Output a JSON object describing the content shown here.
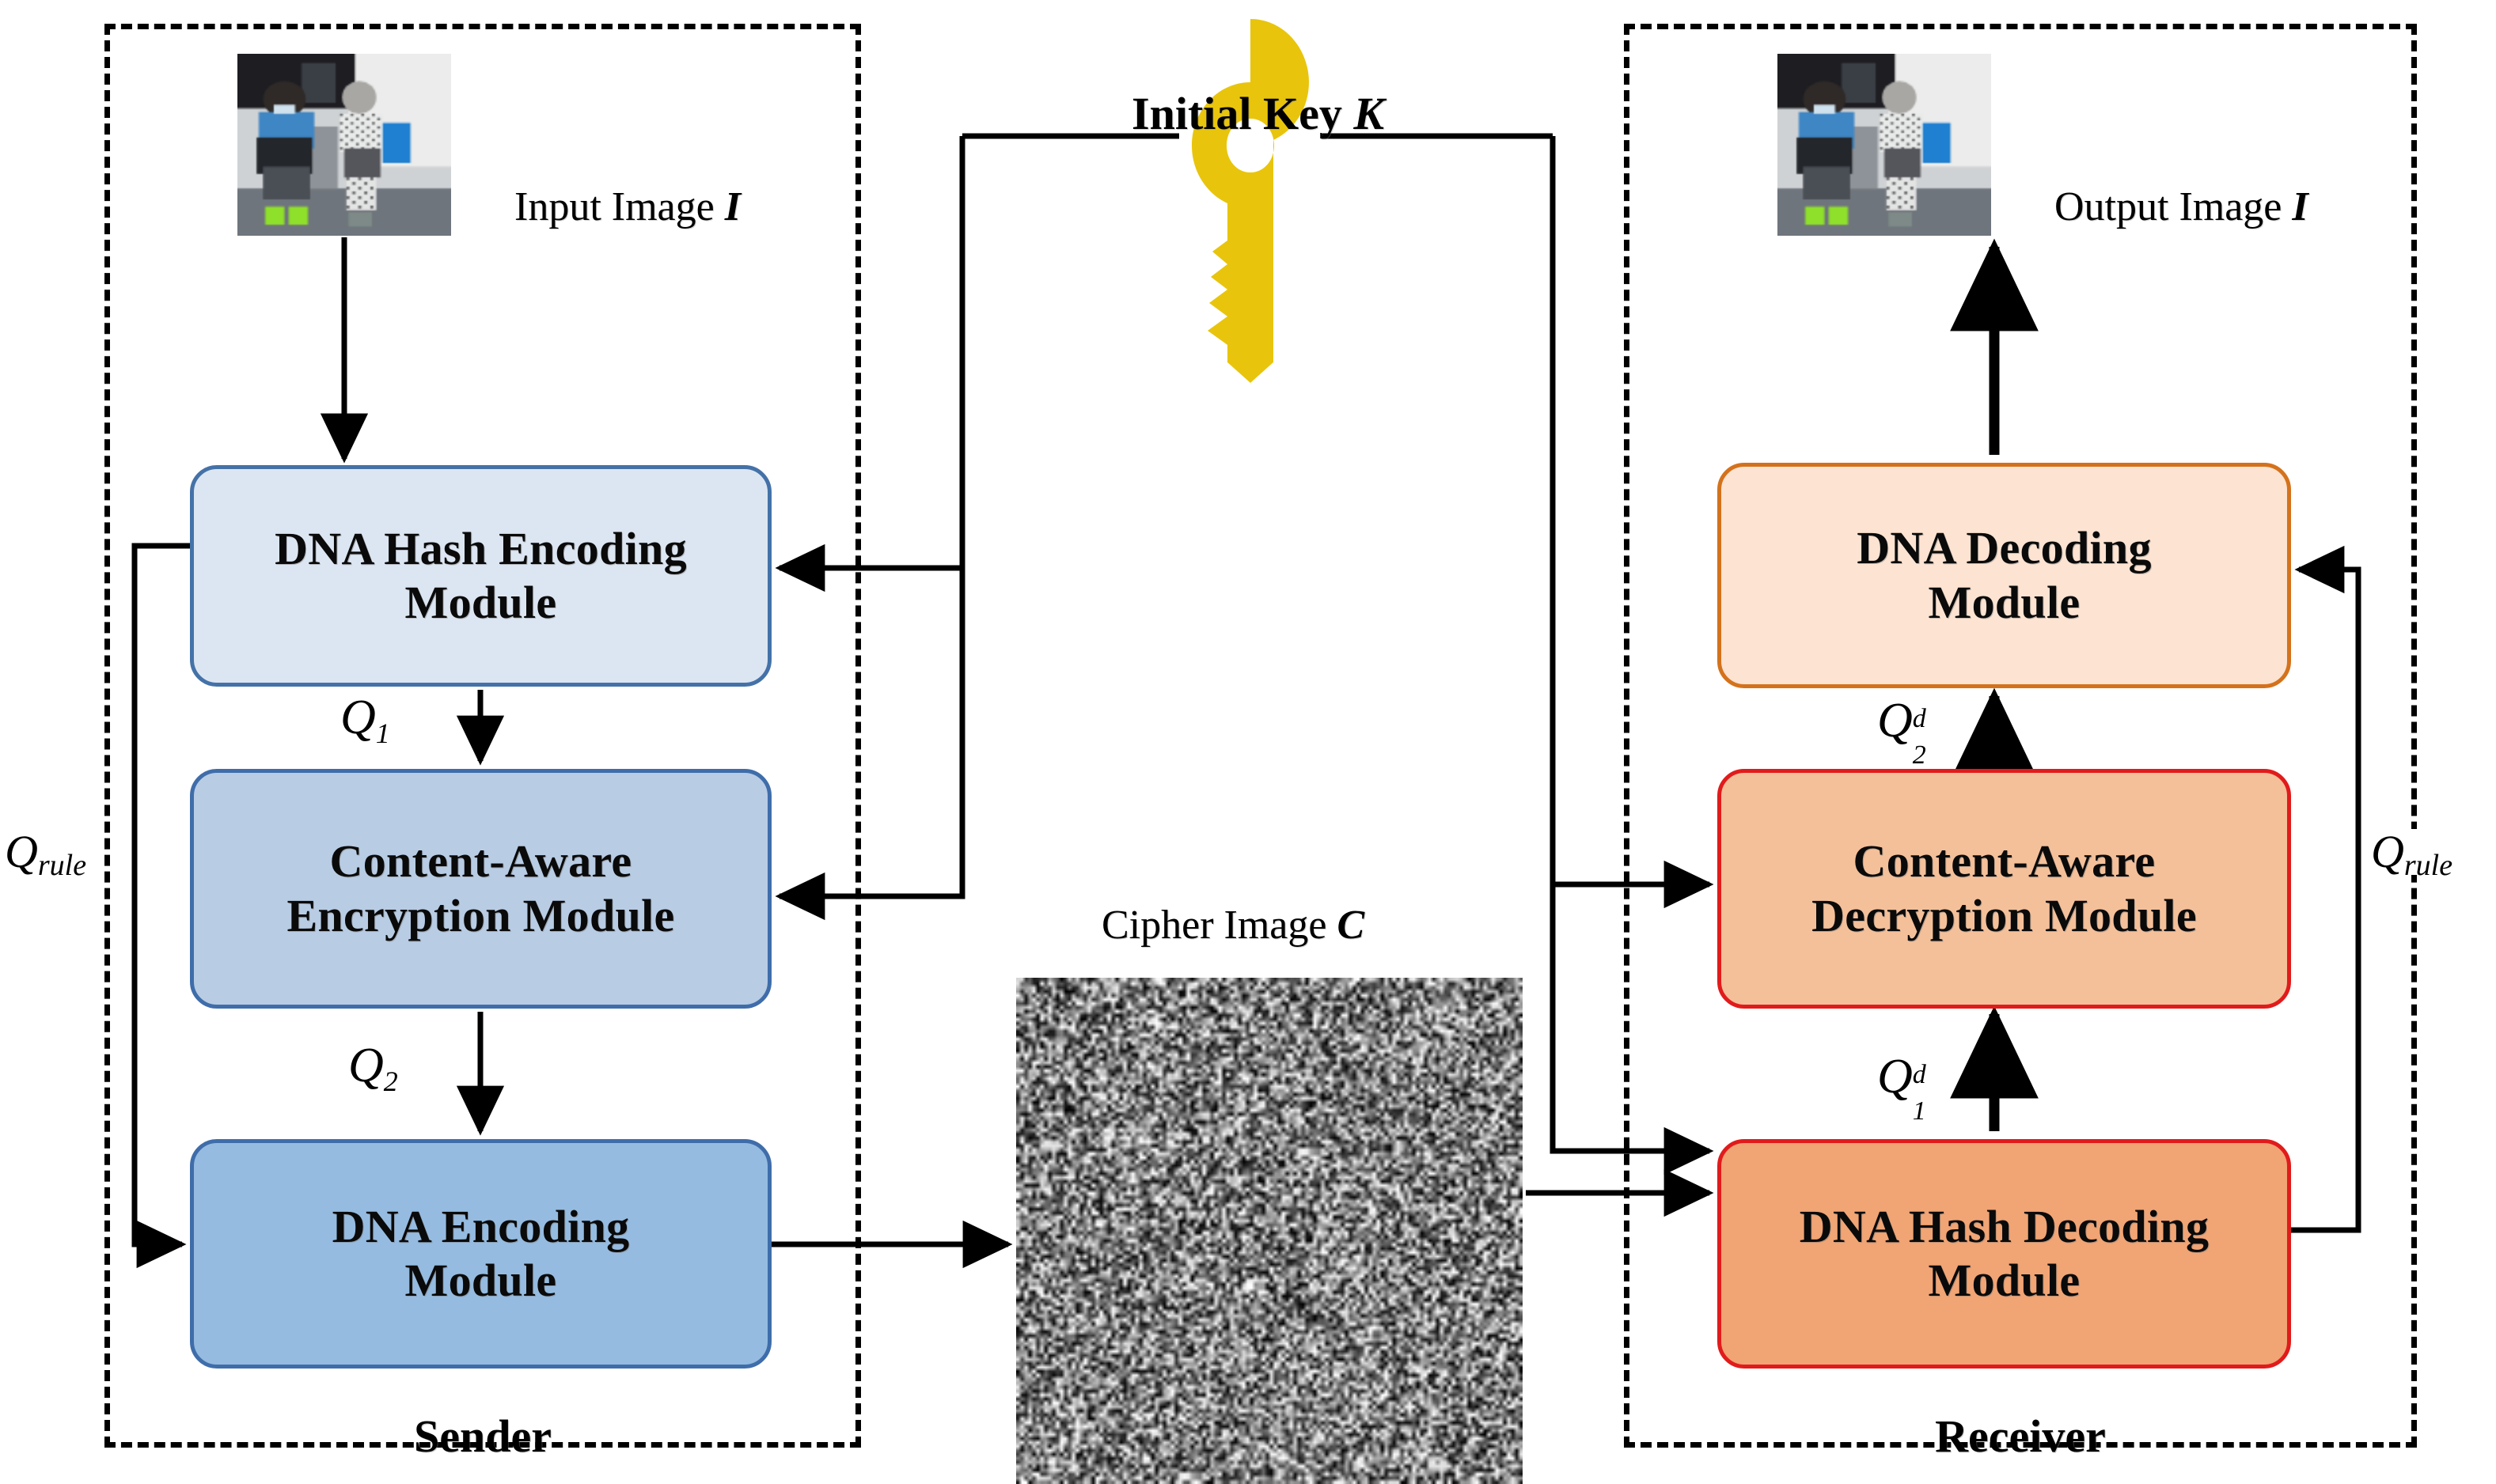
{
  "diagram": {
    "title": "DNA hash encoding / content-aware encryption pipeline",
    "parties": {
      "sender_label": "Sender",
      "receiver_label": "Receiver"
    },
    "center": {
      "key_label": "Initial Key",
      "key_symbol": "K",
      "key_icon": "key-icon",
      "key_color": "#E8C50C",
      "cipher_label": "Cipher Image",
      "cipher_symbol": "C"
    },
    "images": {
      "input_label": "Input Image",
      "input_symbol": "I",
      "output_label": "Output Image",
      "output_symbol": "I"
    },
    "sender_modules": [
      {
        "id": "dna-hash-encoding",
        "line1": "DNA Hash Encoding",
        "line2": "Module",
        "fill": "#dce6f2",
        "stroke": "#4472a8"
      },
      {
        "id": "content-aware-encryption",
        "line1": "Content-Aware",
        "line2": "Encryption Module",
        "fill": "#b8cce4",
        "stroke": "#3f6daa"
      },
      {
        "id": "dna-encoding",
        "line1": "DNA Encoding",
        "line2": "Module",
        "fill": "#95bbe0",
        "stroke": "#3f6daa"
      }
    ],
    "receiver_modules": [
      {
        "id": "dna-decoding",
        "line1": "DNA Decoding",
        "line2": "Module",
        "fill": "#fce3d2",
        "stroke": "#d4721c"
      },
      {
        "id": "content-aware-decryption",
        "line1": "Content-Aware",
        "line2": "Decryption Module",
        "fill": "#f4c09a",
        "stroke": "#e11b1b"
      },
      {
        "id": "dna-hash-decoding",
        "line1": "DNA Hash Decoding",
        "line2": "Module",
        "fill": "#f1a474",
        "stroke": "#e11b1b"
      }
    ],
    "edge_labels": {
      "q1": {
        "base": "Q",
        "sub": "1"
      },
      "q2": {
        "base": "Q",
        "sub": "2"
      },
      "qd1": {
        "base": "Q",
        "sup": "d",
        "sub": "1"
      },
      "qd2": {
        "base": "Q",
        "sup": "d",
        "sub": "2"
      },
      "qrule_left": {
        "base": "Q",
        "sub": "rule"
      },
      "qrule_right": {
        "base": "Q",
        "sub": "rule"
      }
    },
    "colors": {
      "arrow": "#000000",
      "dashed_frame": "#000000",
      "key_yellow": "#E8C50C",
      "sender_accent": "#3f6daa",
      "receiver_accent": "#e11b1b"
    }
  }
}
